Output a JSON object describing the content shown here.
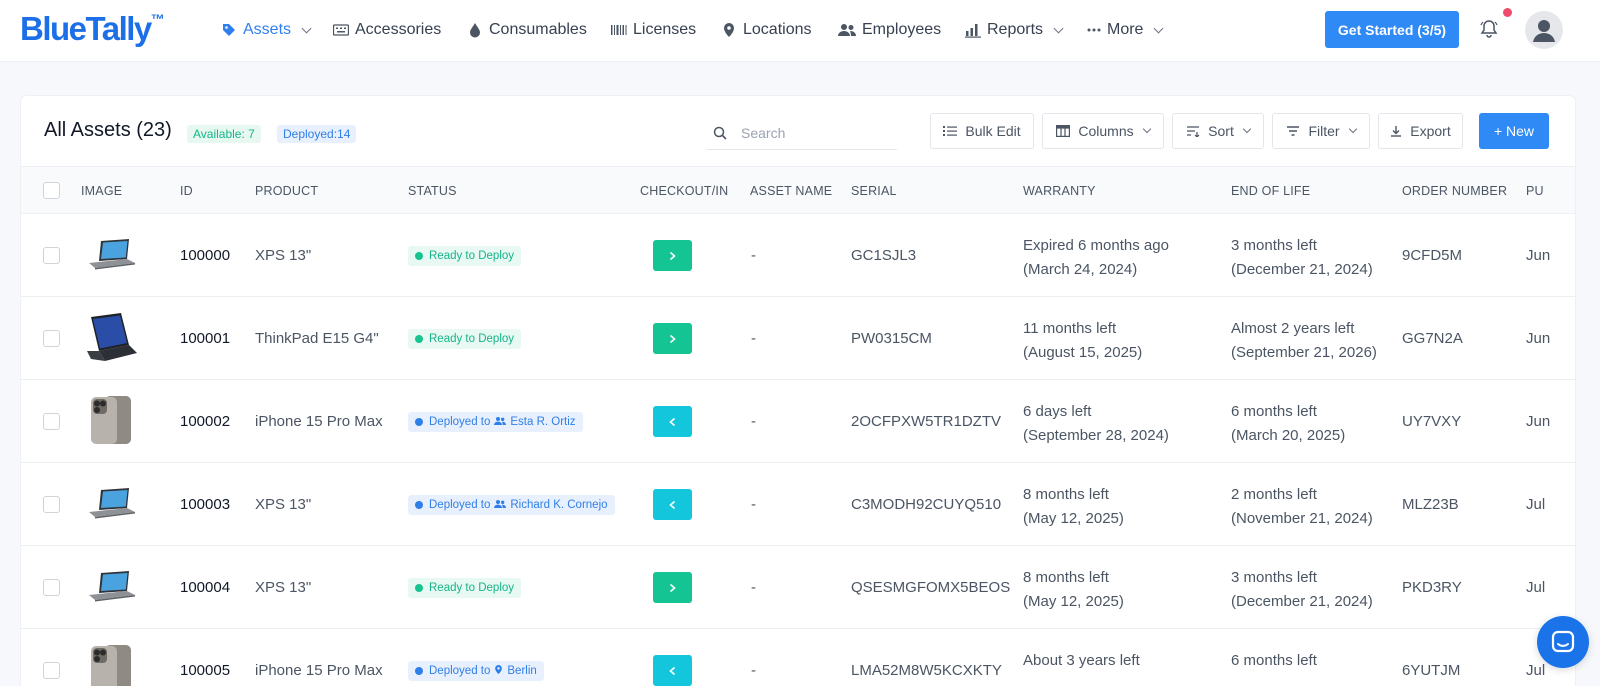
{
  "brand": {
    "name": "BlueTally",
    "tm": "™"
  },
  "nav": {
    "items": [
      {
        "label": "Assets",
        "active": true,
        "dropdown": true,
        "icon": "tag-icon"
      },
      {
        "label": "Accessories",
        "icon": "keyboard-icon"
      },
      {
        "label": "Consumables",
        "icon": "drop-icon"
      },
      {
        "label": "Licenses",
        "icon": "barcode-icon"
      },
      {
        "label": "Locations",
        "icon": "map-pin-icon"
      },
      {
        "label": "Employees",
        "icon": "users-icon"
      },
      {
        "label": "Reports",
        "dropdown": true,
        "icon": "bar-chart-icon"
      },
      {
        "label": "More",
        "dropdown": true,
        "icon": "dots-icon"
      }
    ],
    "get_started": "Get Started (3/5)"
  },
  "assets": {
    "title": "All Assets (23)",
    "available_badge": "Available: 7",
    "deployed_badge": "Deployed:14",
    "search_placeholder": "Search",
    "toolbar": {
      "bulk_edit": "Bulk Edit",
      "columns": "Columns",
      "sort": "Sort",
      "filter": "Filter",
      "export": "Export",
      "new": "+ New"
    },
    "columns": [
      "Image",
      "ID",
      "Product",
      "Status",
      "Checkout/In",
      "Asset Name",
      "Serial",
      "Warranty",
      "End of Life",
      "Order Number",
      "Pu"
    ],
    "rows": [
      {
        "id": "100000",
        "product": "XPS 13\"",
        "status": "Ready to Deploy",
        "status_type": "ready",
        "status_target": "",
        "action": "checkout",
        "asset_name": "-",
        "serial": "GC1SJL3",
        "warranty_1": "Expired 6 months ago",
        "warranty_2": "(March 24, 2024)",
        "eol_1": "3 months left",
        "eol_2": "(December 21, 2024)",
        "order": "9CFD5M",
        "pu": "Jun",
        "image": "laptop-icon"
      },
      {
        "id": "100001",
        "product": "ThinkPad E15 G4\"",
        "status": "Ready to Deploy",
        "status_type": "ready",
        "status_target": "",
        "action": "checkout",
        "asset_name": "-",
        "serial": "PW0315CM",
        "warranty_1": "11 months left",
        "warranty_2": "(August 15, 2025)",
        "eol_1": "Almost 2 years left",
        "eol_2": "(September 21, 2026)",
        "order": "GG7N2A",
        "pu": "Jun",
        "image": "thinkpad-icon"
      },
      {
        "id": "100002",
        "product": "iPhone 15 Pro Max",
        "status": "Deployed to",
        "status_type": "deployed",
        "status_target": "Esta R. Ortiz",
        "target_icon": "users-icon",
        "action": "checkin",
        "asset_name": "-",
        "serial": "2OCFPXW5TR1DZTV",
        "warranty_1": "6 days left",
        "warranty_2": "(September 28, 2024)",
        "eol_1": "6 months left",
        "eol_2": "(March 20, 2025)",
        "order": "UY7VXY",
        "pu": "Jun",
        "image": "iphone-icon"
      },
      {
        "id": "100003",
        "product": "XPS 13\"",
        "status": "Deployed to",
        "status_type": "deployed",
        "status_target": "Richard K. Cornejo",
        "target_icon": "users-icon",
        "action": "checkin",
        "asset_name": "-",
        "serial": "C3MODH92CUYQ510",
        "warranty_1": "8 months left",
        "warranty_2": "(May 12, 2025)",
        "eol_1": "2 months left",
        "eol_2": "(November 21, 2024)",
        "order": "MLZ23B",
        "pu": "Jul",
        "image": "laptop-icon"
      },
      {
        "id": "100004",
        "product": "XPS 13\"",
        "status": "Ready to Deploy",
        "status_type": "ready",
        "status_target": "",
        "action": "checkout",
        "asset_name": "-",
        "serial": "QSESMGFOMX5BEOS",
        "warranty_1": "8 months left",
        "warranty_2": "(May 12, 2025)",
        "eol_1": "3 months left",
        "eol_2": "(December 21, 2024)",
        "order": "PKD3RY",
        "pu": "Jul",
        "image": "laptop-icon"
      },
      {
        "id": "100005",
        "product": "iPhone 15 Pro Max",
        "status": "Deployed to",
        "status_type": "deployed",
        "status_target": "Berlin",
        "target_icon": "map-pin-icon",
        "action": "checkin",
        "asset_name": "-",
        "serial": "LMA52M8W5KCXKTY",
        "warranty_1": "About 3 years left",
        "warranty_2": "",
        "eol_1": "6 months left",
        "eol_2": "",
        "order": "6YUTJM",
        "pu": "Jul",
        "image": "iphone-icon"
      }
    ]
  },
  "colors": {
    "brand": "#1d6fe8",
    "primary": "#2f8af5",
    "ready": "#17b489",
    "deployed": "#2f7fe8",
    "checkout": "#14c493",
    "checkin": "#14c6dc"
  }
}
